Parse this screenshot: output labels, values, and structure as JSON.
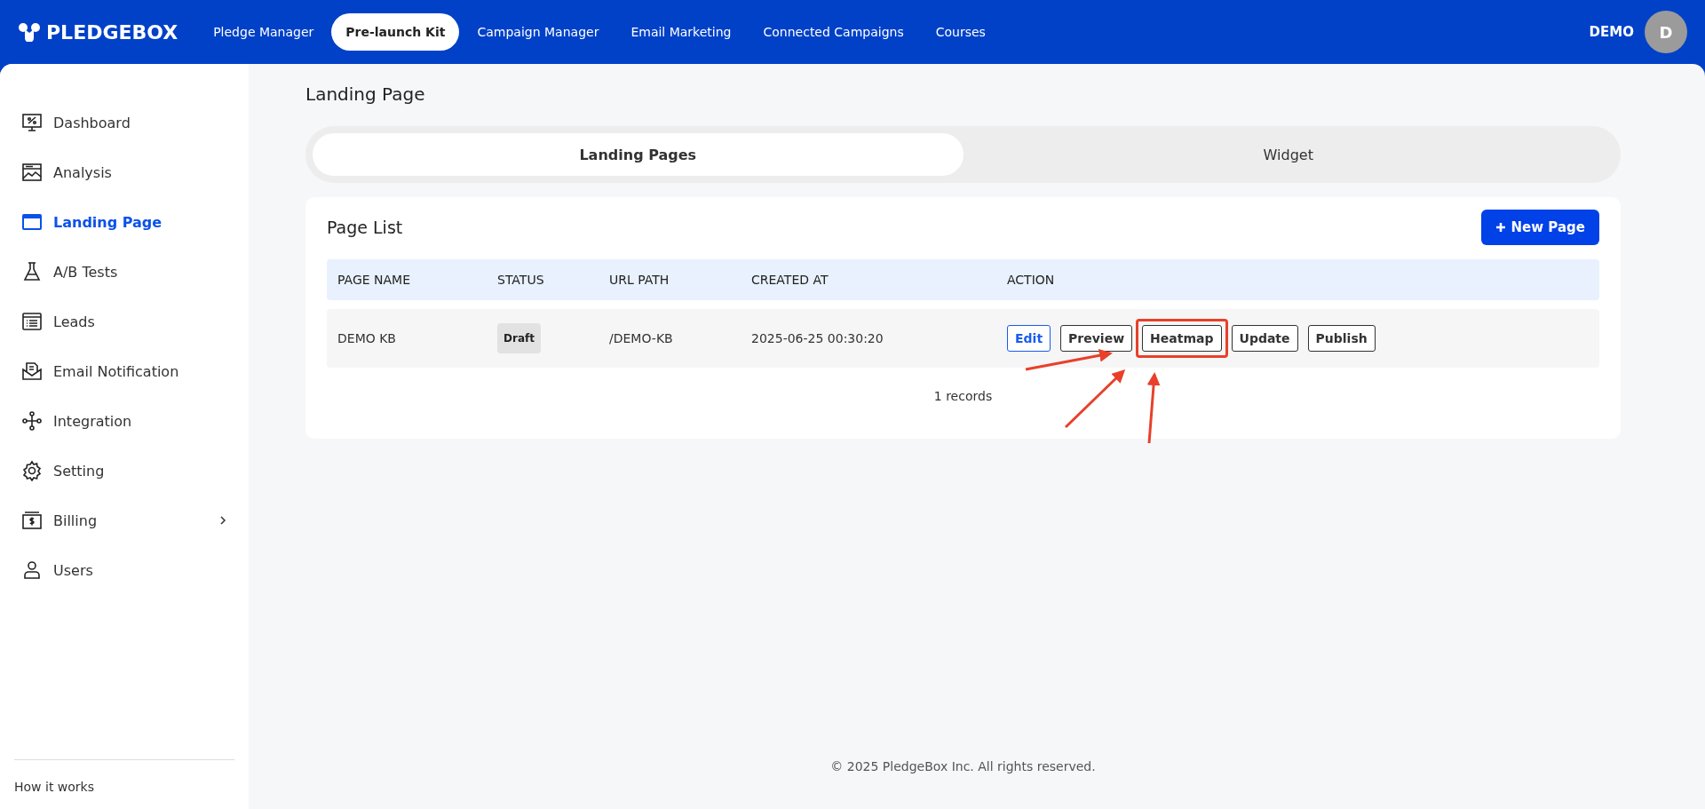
{
  "header": {
    "logo": "PLEDGEBOX",
    "nav": [
      {
        "label": "Pledge Manager",
        "selected": false
      },
      {
        "label": "Pre-launch Kit",
        "selected": true
      },
      {
        "label": "Campaign Manager",
        "selected": false
      },
      {
        "label": "Email Marketing",
        "selected": false
      },
      {
        "label": "Connected Campaigns",
        "selected": false
      },
      {
        "label": "Courses",
        "selected": false
      }
    ],
    "user": "DEMO",
    "avatar": "D"
  },
  "sidebar": {
    "items": [
      {
        "label": "Dashboard",
        "selected": false
      },
      {
        "label": "Analysis",
        "selected": false
      },
      {
        "label": "Landing Page",
        "selected": true
      },
      {
        "label": "A/B Tests",
        "selected": false
      },
      {
        "label": "Leads",
        "selected": false
      },
      {
        "label": "Email Notification",
        "selected": false
      },
      {
        "label": "Integration",
        "selected": false
      },
      {
        "label": "Setting",
        "selected": false
      },
      {
        "label": "Billing",
        "selected": false,
        "expandable": true
      },
      {
        "label": "Users",
        "selected": false
      }
    ],
    "footer": "How it works"
  },
  "page_title": "Landing Page",
  "tabs": [
    {
      "label": "Landing Pages",
      "selected": true
    },
    {
      "label": "Widget",
      "selected": false
    }
  ],
  "card": {
    "title": "Page List",
    "new_button": "New Page",
    "table": {
      "columns": [
        "PAGE NAME",
        "STATUS",
        "URL PATH",
        "CREATED AT",
        "ACTION"
      ],
      "rows": [
        {
          "name": "DEMO KB",
          "status": "Draft",
          "url": "/DEMO-KB",
          "created": "2025-06-25 00:30:20",
          "actions": [
            {
              "label": "Edit",
              "kind": "primary",
              "highlighted": false
            },
            {
              "label": "Preview",
              "kind": "default",
              "highlighted": false
            },
            {
              "label": "Heatmap",
              "kind": "default",
              "highlighted": true
            },
            {
              "label": "Update",
              "kind": "default",
              "highlighted": false
            },
            {
              "label": "Publish",
              "kind": "default",
              "highlighted": false
            }
          ]
        }
      ]
    },
    "records": "1 records"
  },
  "footer": "© 2025 PledgeBox Inc. All rights reserved."
}
